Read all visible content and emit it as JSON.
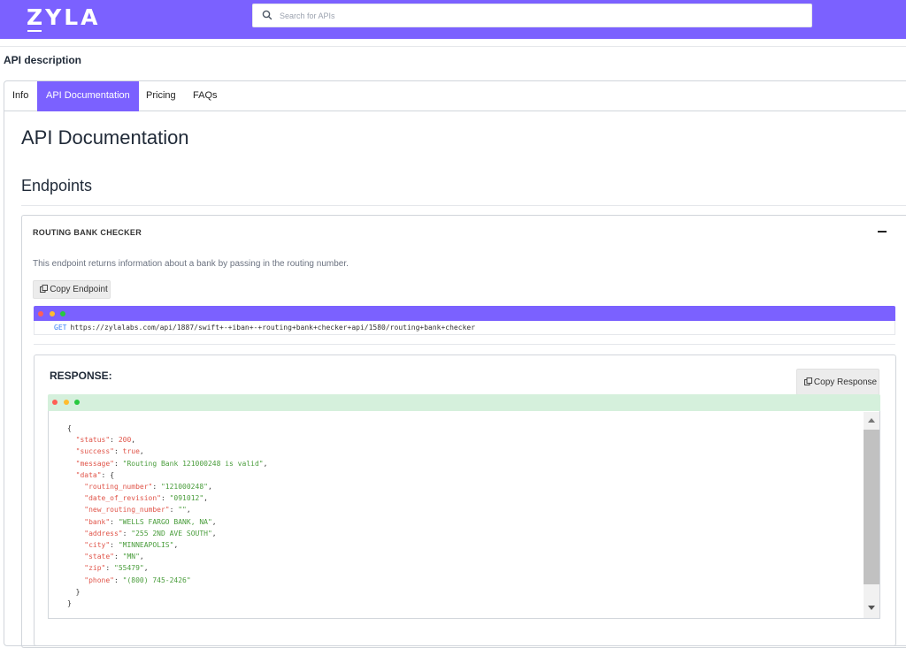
{
  "header": {
    "logo_text": "ZYLA",
    "search_placeholder": "Search for APIs",
    "brand_color": "#7b61ff"
  },
  "page": {
    "section_label": "API description"
  },
  "tabs": [
    {
      "label": "Info",
      "active": false
    },
    {
      "label": "API Documentation",
      "active": true
    },
    {
      "label": "Pricing",
      "active": false
    },
    {
      "label": "FAQs",
      "active": false
    }
  ],
  "docs": {
    "title": "API Documentation",
    "endpoints_heading": "Endpoints"
  },
  "endpoint": {
    "name": "ROUTING BANK CHECKER",
    "description": "This endpoint returns information about a bank by passing in the routing number.",
    "copy_endpoint_label": "Copy Endpoint",
    "method": "GET",
    "url": "https://zylalabs.com/api/1887/swift+-+iban+-+routing+bank+checker+api/1580/routing+bank+checker",
    "collapse_icon": "minus-icon"
  },
  "response": {
    "title": "RESPONSE:",
    "copy_response_label": "Copy Response",
    "json_lines": {
      "open": "{",
      "status_key": "\"status\"",
      "status_val": "200",
      "success_key": "\"success\"",
      "success_val": "true",
      "message_key": "\"message\"",
      "message_val": "\"Routing Bank 121000248 is valid\"",
      "data_key": "\"data\"",
      "data_open": "{",
      "routing_number_key": "\"routing_number\"",
      "routing_number_val": "\"121000248\"",
      "date_of_revision_key": "\"date_of_revision\"",
      "date_of_revision_val": "\"091012\"",
      "new_routing_number_key": "\"new_routing_number\"",
      "new_routing_number_val": "\"\"",
      "bank_key": "\"bank\"",
      "bank_val": "\"WELLS FARGO BANK, NA\"",
      "address_key": "\"address\"",
      "address_val": "\"255 2ND AVE SOUTH\"",
      "city_key": "\"city\"",
      "city_val": "\"MINNEAPOLIS\"",
      "state_key": "\"state\"",
      "state_val": "\"MN\"",
      "zip_key": "\"zip\"",
      "zip_val": "\"55479\"",
      "phone_key": "\"phone\"",
      "phone_val": "\"(800) 745-2426\"",
      "data_close": "}",
      "close": "}"
    }
  },
  "colors": {
    "dot_red": "#ff5f56",
    "dot_yellow": "#ffbd2e",
    "dot_green": "#27c93f",
    "response_bar": "#d5f0dc"
  }
}
